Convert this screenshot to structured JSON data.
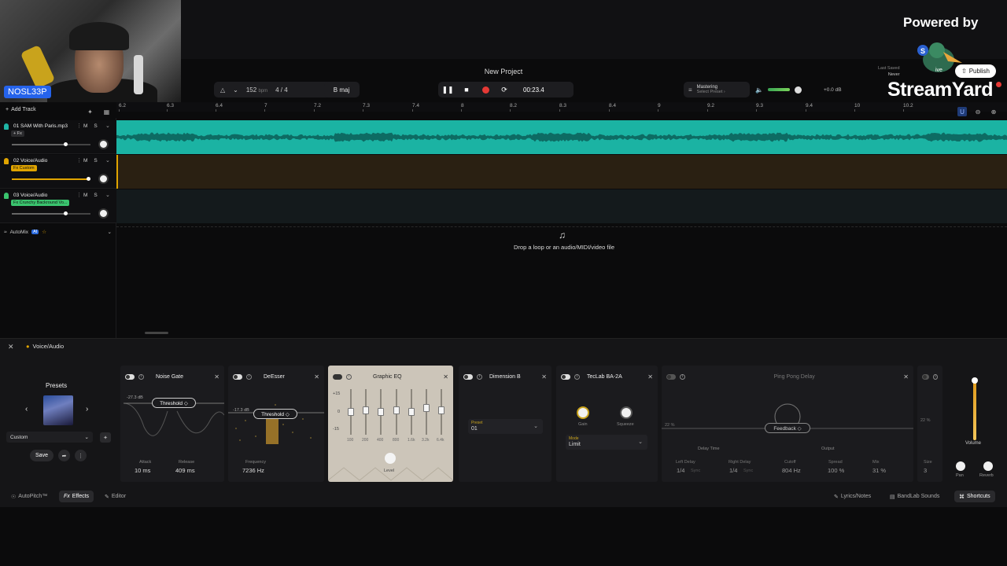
{
  "stream": {
    "name_tag": "NOSL33P",
    "powered_by": "Powered by",
    "brand": "StreamYard",
    "live": "ive"
  },
  "header": {
    "project_title": "New Project",
    "tempo": "152",
    "tempo_unit": "bpm",
    "time_sig": "4 / 4",
    "key": "B maj",
    "time": "00:23.4",
    "mastering_title": "Mastering",
    "mastering_sub": "Select Preset ›",
    "master_db": "+0.0 dB",
    "last_saved_label": "Last Saved",
    "last_saved_value": "Never",
    "publish": "Publish"
  },
  "ruler": [
    "6.2",
    "6.3",
    "6.4",
    "7",
    "7.2",
    "7.3",
    "7.4",
    "8",
    "8.2",
    "8.3",
    "8.4",
    "9",
    "9.2",
    "9.3",
    "9.4",
    "10",
    "10.2"
  ],
  "tracklist": {
    "add_track": "Add Track",
    "tracks": [
      {
        "name": "01  SAM With Paris.mp3",
        "fx": "+ Fx",
        "color": "#1fb5a6"
      },
      {
        "name": "02  Voice/Audio",
        "fx": "Fx Custom",
        "color": "#e0a400"
      },
      {
        "name": "03  Voice/Audio",
        "fx": "Fx Crunchy Backround Vo...",
        "color": "#3ac46e"
      }
    ],
    "mute": "M",
    "solo": "S",
    "automix": "AutoMix",
    "ai": "AI"
  },
  "dropzone": {
    "text": "Drop a loop or an audio/MIDI/video file"
  },
  "fx_panel": {
    "title": "Voice/Audio",
    "presets_label": "Presets",
    "preset_value": "Custom",
    "save": "Save",
    "noise_gate": {
      "title": "Noise Gate",
      "threshold_value": "-27.3 dB",
      "threshold": "Threshold ◇",
      "attack_label": "Attack",
      "attack": "10 ms",
      "release_label": "Release",
      "release": "409 ms"
    },
    "deesser": {
      "title": "DeEsser",
      "threshold_value": "-17.3 dB",
      "threshold": "Threshold ◇",
      "frequency_label": "Frequency",
      "frequency": "7236 Hz"
    },
    "graphic_eq": {
      "title": "Graphic EQ",
      "scale": [
        "+15",
        "0",
        "-15"
      ],
      "freqs": [
        "100",
        "200",
        "400",
        "800",
        "1.6k",
        "3.2k",
        "6.4k"
      ],
      "level": "Level"
    },
    "dimension": {
      "title": "Dimension B",
      "preset_label": "Preset",
      "preset_value": "01"
    },
    "teclab": {
      "title": "TecLab BA-2A",
      "gain": "Gain",
      "squeeze": "Squeeze",
      "mode_label": "Mode",
      "mode_value": "Limit"
    },
    "pingpong": {
      "title": "Ping Pong Delay",
      "feedback": "Feedback ◇",
      "feedback_value": "22 %",
      "delay_time": "Delay Time",
      "output": "Output",
      "left_delay_label": "Left Delay",
      "left_delay": "1/4",
      "left_delay_sync": "Sync",
      "right_delay_label": "Right Delay",
      "right_delay": "1/4",
      "right_delay_sync": "Sync",
      "cutoff_label": "Cutoff",
      "cutoff": "804 Hz",
      "spread_label": "Spread",
      "spread": "100 %",
      "mix_label": "Mix",
      "mix": "31 %"
    },
    "reverb": {
      "value": "22 %",
      "size_label": "Size",
      "size": "3"
    },
    "volume": "Volume",
    "pan": "Pan",
    "reverb_label": "Reverb"
  },
  "bottom_tabs": {
    "autopitch": "AutoPitch™",
    "effects": "Effects",
    "editor": "Editor",
    "lyrics": "Lyrics/Notes",
    "sounds": "BandLab Sounds",
    "shortcuts": "Shortcuts"
  }
}
